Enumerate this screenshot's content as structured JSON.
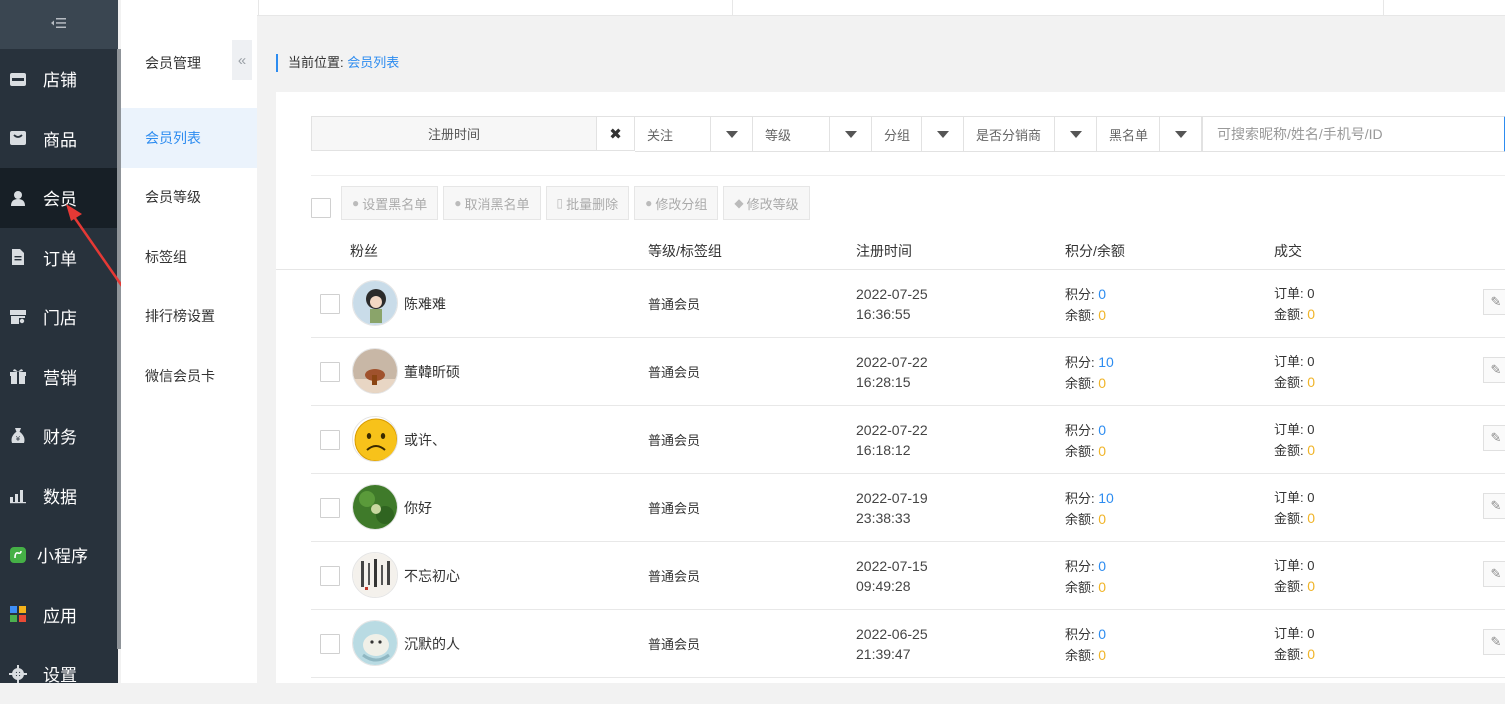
{
  "nav": {
    "toggle_icon": "collapse-menu-icon",
    "items": [
      {
        "label": "店铺",
        "icon": "store-icon"
      },
      {
        "label": "商品",
        "icon": "goods-box-icon"
      },
      {
        "label": "会员",
        "icon": "user-icon",
        "active": true
      },
      {
        "label": "订单",
        "icon": "document-icon"
      },
      {
        "label": "门店",
        "icon": "shop-icon"
      },
      {
        "label": "营销",
        "icon": "gift-icon"
      },
      {
        "label": "财务",
        "icon": "money-bag-icon"
      },
      {
        "label": "数据",
        "icon": "bar-chart-icon"
      },
      {
        "label": "小程序",
        "icon": "mini-program-icon"
      },
      {
        "label": "应用",
        "icon": "apps-icon"
      },
      {
        "label": "设置",
        "icon": "gear-icon"
      }
    ]
  },
  "submenu": {
    "title": "会员管理",
    "collapse_glyph": "«",
    "items": [
      {
        "label": "会员列表",
        "active": true
      },
      {
        "label": "会员等级"
      },
      {
        "label": "标签组"
      },
      {
        "label": "排行榜设置"
      },
      {
        "label": "微信会员卡"
      }
    ]
  },
  "breadcrumb": {
    "prefix": "当前位置:",
    "current": "会员列表"
  },
  "filters": {
    "date_label": "注册时间",
    "clear_glyph": "✖",
    "selects": [
      "关注",
      "等级",
      "分组",
      "是否分销商",
      "黑名单"
    ],
    "search_placeholder": "可搜索昵称/姓名/手机号/ID"
  },
  "bulk_actions": [
    "设置黑名单",
    "取消黑名单",
    "批量删除",
    "修改分组",
    "修改等级"
  ],
  "table": {
    "headers": [
      "粉丝",
      "等级/标签组",
      "注册时间",
      "积分/余额",
      "成交"
    ],
    "score_label": "积分:",
    "balance_label": "余额:",
    "orders_label": "订单:",
    "amount_label": "金额:",
    "rows": [
      {
        "name": "陈难难",
        "level": "普通会员",
        "date": "2022-07-25",
        "time": "16:36:55",
        "score": "0",
        "balance": "0",
        "orders": "0",
        "amount": "0"
      },
      {
        "name": "董韓昕硕",
        "level": "普通会员",
        "date": "2022-07-22",
        "time": "16:28:15",
        "score": "10",
        "balance": "0",
        "orders": "0",
        "amount": "0"
      },
      {
        "name": "或许、",
        "level": "普通会员",
        "date": "2022-07-22",
        "time": "16:18:12",
        "score": "0",
        "balance": "0",
        "orders": "0",
        "amount": "0"
      },
      {
        "name": "你好",
        "level": "普通会员",
        "date": "2022-07-19",
        "time": "23:38:33",
        "score": "10",
        "balance": "0",
        "orders": "0",
        "amount": "0"
      },
      {
        "name": "不忘初心",
        "level": "普通会员",
        "date": "2022-07-15",
        "time": "09:49:28",
        "score": "0",
        "balance": "0",
        "orders": "0",
        "amount": "0"
      },
      {
        "name": "沉默的人",
        "level": "普通会员",
        "date": "2022-06-25",
        "time": "21:39:47",
        "score": "0",
        "balance": "0",
        "orders": "0",
        "amount": "0"
      }
    ]
  },
  "colors": {
    "accent": "#2d8cf0",
    "orange": "#f0b428",
    "nav_bg": "#28323c"
  }
}
